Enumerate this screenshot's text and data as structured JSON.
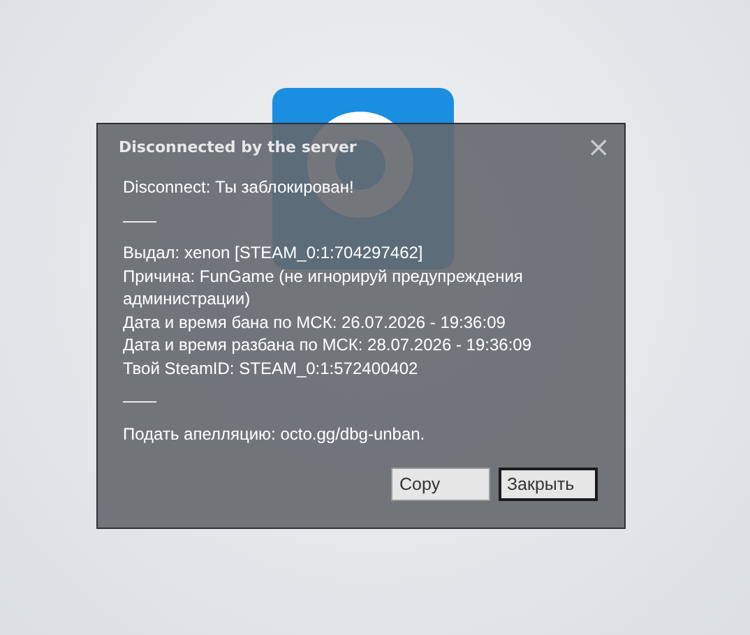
{
  "dialog": {
    "title": "Disconnected by the server",
    "close": "×",
    "paragraphs": [
      [
        "Disconnect: Ты заблокирован!"
      ],
      [
        "——"
      ],
      [
        "Выдал: xenon [STEAM_0:1:704297462]",
        "Причина: FunGame (не игнорируй предупреждения администрации)",
        "Дата и время бана по МСК: 26.07.2026 - 19:36:09",
        "Дата и время разбана по МСК: 28.07.2026 - 19:36:09",
        "Твой SteamID: STEAM_0:1:572400402"
      ],
      [
        "——"
      ],
      [
        "Подать апелляцию: octo.gg/dbg-unban."
      ]
    ],
    "buttons": [
      {
        "label": "Copy",
        "focused": false
      },
      {
        "label": "Закрыть",
        "focused": true
      }
    ]
  }
}
